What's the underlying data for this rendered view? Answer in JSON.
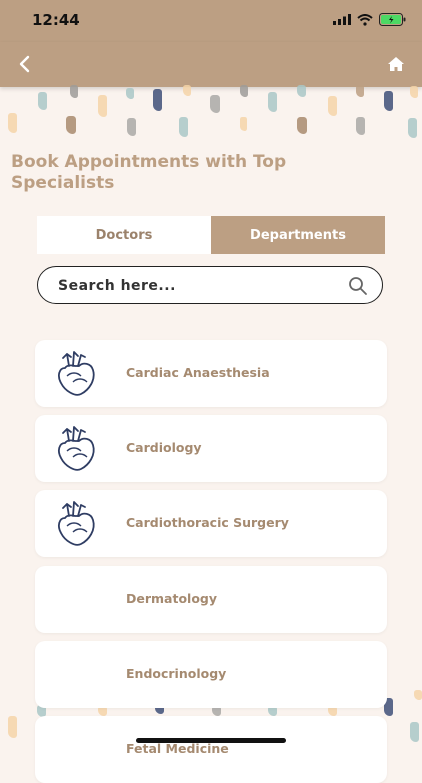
{
  "status_bar": {
    "time": "12:44"
  },
  "nav": {
    "back_icon": "chevron-left-icon",
    "home_icon": "home-icon"
  },
  "page": {
    "title": "Book Appointments with Top Specialists"
  },
  "tabs": [
    {
      "label": "Doctors",
      "active": false
    },
    {
      "label": "Departments",
      "active": true
    }
  ],
  "search": {
    "placeholder": "Search here...",
    "value": "",
    "icon": "search-icon"
  },
  "departments": [
    {
      "label": "Cardiac Anaesthesia",
      "icon": "heart-icon"
    },
    {
      "label": "Cardiology",
      "icon": "heart-icon"
    },
    {
      "label": "Cardiothoracic Surgery",
      "icon": "heart-icon"
    },
    {
      "label": "Dermatology",
      "icon": ""
    },
    {
      "label": "Endocrinology",
      "icon": ""
    },
    {
      "label": "Fetal Medicine",
      "icon": ""
    }
  ],
  "colors": {
    "brand": "#bc9f83",
    "background": "#faf3ee",
    "icon_navy": "#2f3d63"
  }
}
